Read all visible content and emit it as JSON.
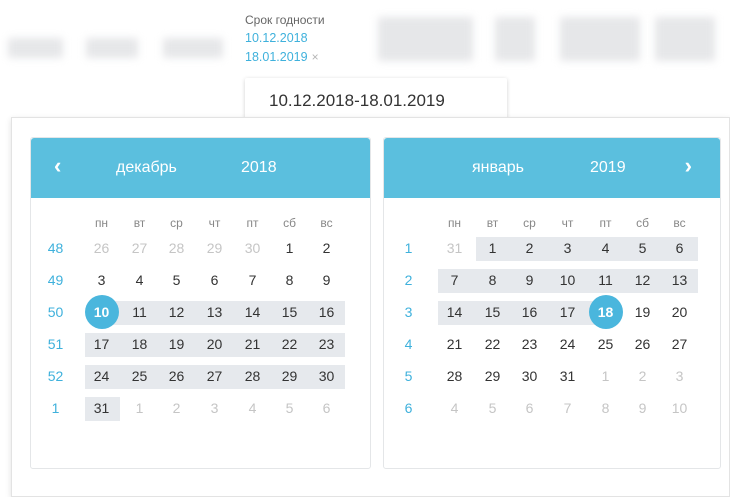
{
  "filter": {
    "label": "Срок годности",
    "date_from": "10.12.2018",
    "date_to": "18.01.2019",
    "clear_icon": "×"
  },
  "range_input": {
    "value": "10.12.2018-18.01.2019"
  },
  "weekdays": [
    "пн",
    "вт",
    "ср",
    "чт",
    "пт",
    "сб",
    "вс"
  ],
  "colors": {
    "accent": "#5bbfde",
    "selected": "#4ab6dd",
    "range_band": "#e6e9ed",
    "week_number": "#3fb1dc"
  },
  "calendars": [
    {
      "month": "декабрь",
      "year": "2018",
      "nav_icon": "‹",
      "weeks": [
        {
          "num": "48",
          "days": [
            "26",
            "27",
            "28",
            "29",
            "30",
            "1",
            "2"
          ],
          "muted": [
            true,
            true,
            true,
            true,
            true,
            false,
            false
          ]
        },
        {
          "num": "49",
          "days": [
            "3",
            "4",
            "5",
            "6",
            "7",
            "8",
            "9"
          ],
          "muted": [
            false,
            false,
            false,
            false,
            false,
            false,
            false
          ]
        },
        {
          "num": "50",
          "days": [
            "10",
            "11",
            "12",
            "13",
            "14",
            "15",
            "16"
          ],
          "muted": [
            false,
            false,
            false,
            false,
            false,
            false,
            false
          ]
        },
        {
          "num": "51",
          "days": [
            "17",
            "18",
            "19",
            "20",
            "21",
            "22",
            "23"
          ],
          "muted": [
            false,
            false,
            false,
            false,
            false,
            false,
            false
          ]
        },
        {
          "num": "52",
          "days": [
            "24",
            "25",
            "26",
            "27",
            "28",
            "29",
            "30"
          ],
          "muted": [
            false,
            false,
            false,
            false,
            false,
            false,
            false
          ]
        },
        {
          "num": "1",
          "days": [
            "31",
            "1",
            "2",
            "3",
            "4",
            "5",
            "6"
          ],
          "muted": [
            false,
            true,
            true,
            true,
            true,
            true,
            true
          ]
        }
      ]
    },
    {
      "month": "январь",
      "year": "2019",
      "nav_icon": "›",
      "weeks": [
        {
          "num": "1",
          "days": [
            "31",
            "1",
            "2",
            "3",
            "4",
            "5",
            "6"
          ],
          "muted": [
            true,
            false,
            false,
            false,
            false,
            false,
            false
          ]
        },
        {
          "num": "2",
          "days": [
            "7",
            "8",
            "9",
            "10",
            "11",
            "12",
            "13"
          ],
          "muted": [
            false,
            false,
            false,
            false,
            false,
            false,
            false
          ]
        },
        {
          "num": "3",
          "days": [
            "14",
            "15",
            "16",
            "17",
            "18",
            "19",
            "20"
          ],
          "muted": [
            false,
            false,
            false,
            false,
            false,
            false,
            false
          ]
        },
        {
          "num": "4",
          "days": [
            "21",
            "22",
            "23",
            "24",
            "25",
            "26",
            "27"
          ],
          "muted": [
            false,
            false,
            false,
            false,
            false,
            false,
            false
          ]
        },
        {
          "num": "5",
          "days": [
            "28",
            "29",
            "30",
            "31",
            "1",
            "2",
            "3"
          ],
          "muted": [
            false,
            false,
            false,
            false,
            true,
            true,
            true
          ]
        },
        {
          "num": "6",
          "days": [
            "4",
            "5",
            "6",
            "7",
            "8",
            "9",
            "10"
          ],
          "muted": [
            true,
            true,
            true,
            true,
            true,
            true,
            true
          ]
        }
      ]
    }
  ]
}
